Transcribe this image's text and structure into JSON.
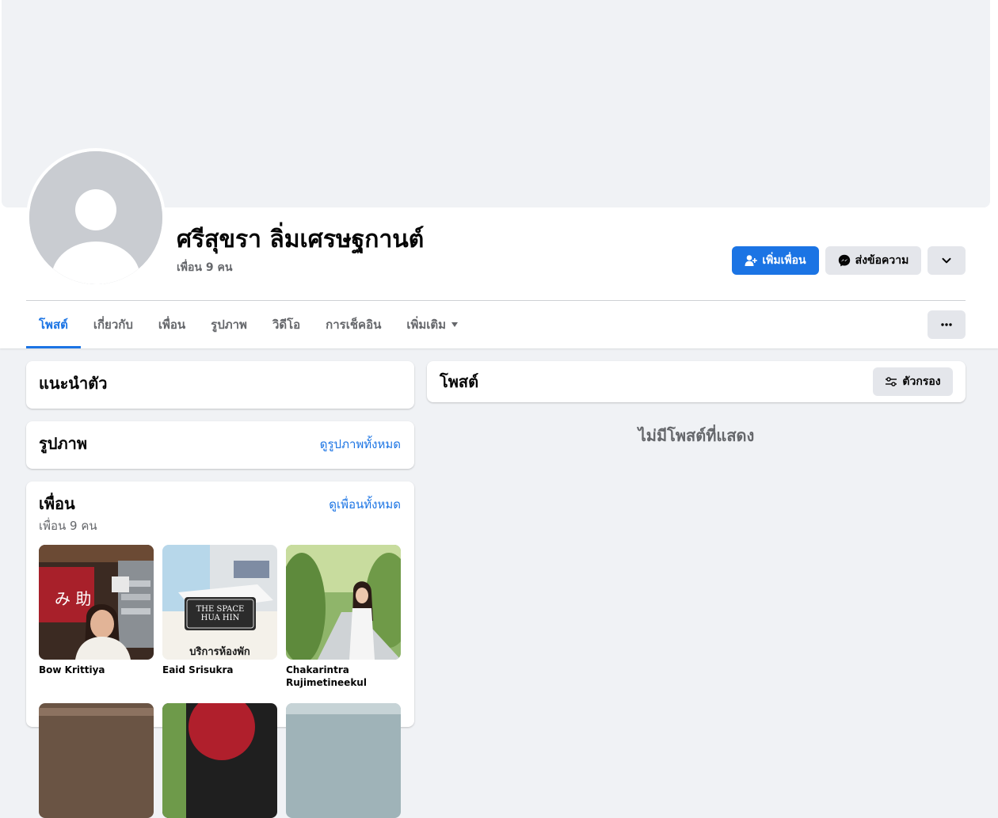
{
  "profile": {
    "name": "ศรีสุขรา ลิ่มเศรษฐกานต์",
    "friend_count": "เพื่อน 9 คน"
  },
  "actions": {
    "add_friend": "เพิ่มเพื่อน",
    "message": "ส่งข้อความ"
  },
  "tabs": [
    {
      "label": "โพสต์",
      "active": true
    },
    {
      "label": "เกี่ยวกับ",
      "active": false
    },
    {
      "label": "เพื่อน",
      "active": false
    },
    {
      "label": "รูปภาพ",
      "active": false
    },
    {
      "label": "วิดีโอ",
      "active": false
    },
    {
      "label": "การเช็คอิน",
      "active": false
    },
    {
      "label": "เพิ่มเติม",
      "active": false
    }
  ],
  "intro": {
    "title": "แนะนำตัว"
  },
  "photos": {
    "title": "รูปภาพ",
    "see_all": "ดูรูปภาพทั้งหมด"
  },
  "friends": {
    "title": "เพื่อน",
    "see_all": "ดูเพื่อนทั้งหมด",
    "count": "เพื่อน 9 คน",
    "items": [
      {
        "name": "Bow Krittiya"
      },
      {
        "name": "Eaid Srisukra",
        "photo_caption": "บริการห้องพัก",
        "photo_sign": "THE SPACE",
        "photo_sign_2": "HUA HIN"
      },
      {
        "name": "Chakarintra Rujimetineekul"
      }
    ]
  },
  "posts": {
    "title": "โพสต์",
    "filter": "ตัวกรอง",
    "empty": "ไม่มีโพสต์ที่แสดง"
  },
  "colors": {
    "accent": "#1b74e4",
    "page_bg": "#f0f2f5",
    "secondary_text": "#65676b"
  }
}
